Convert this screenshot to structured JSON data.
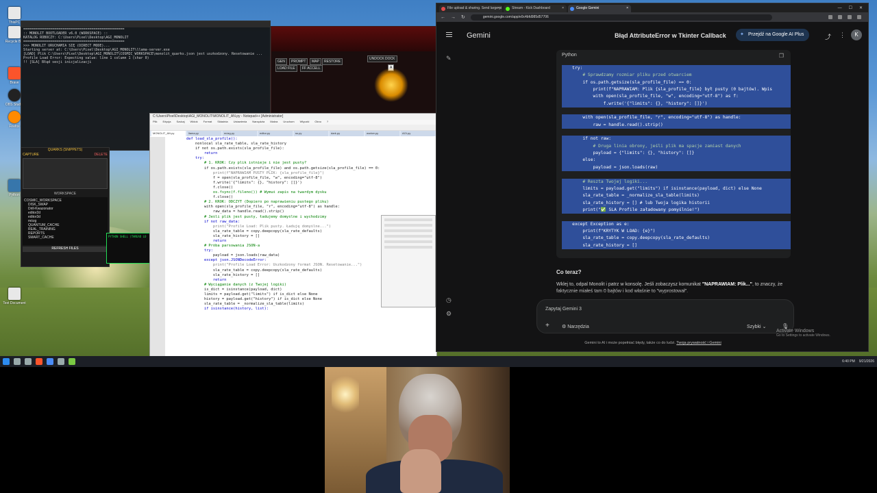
{
  "desktop": {
    "icons": [
      {
        "label": "ThisPC"
      },
      {
        "label": "Recycle Bin"
      },
      {
        "label": "Brave"
      },
      {
        "label": "OBS Studio"
      },
      {
        "label": "Firefox"
      },
      {
        "label": "Python"
      },
      {
        "label": "Text Document"
      }
    ]
  },
  "terminal": {
    "lines": [
      "=================================================",
      ":: MONOLIT BOOTLOADER v6.0 (WORKSPACE) ::",
      "KATALOG ROBOCZY: C:\\Users\\Pixel\\Desktop\\AGI_MONOLIT",
      "=================================================",
      ">>> MONOLIT URUCHAMIA SIĘ (DIRECT MODE)...",
      "Starting server at: C:\\Users\\Pixel\\Desktop\\AGI_MONOLIT\\llama-server.exe",
      "[LOAD] Plik C:\\Users\\Pixel\\Desktop\\AGI_MONOLIT\\COSMIC_WORKSPACE\\monolit_quarks.json jest uszkodzony. Resetowanie ...",
      "Profile Load Error: Expecting value: line 1 column 1 (char 0)",
      "!! [SLA] Błąd sesji inicjalizacji"
    ]
  },
  "darkapp": {
    "tab_label": "UNDOCK  DOCK",
    "input_value": "A",
    "buttons": [
      "GEN",
      "PROMPT",
      "MAP",
      "RESTORE",
      "LOAD FILE",
      "FF ACCELL"
    ]
  },
  "quarks": {
    "title": "QUARKS (SNIPPETS)",
    "capture": "CAPTURE",
    "delete": "DELETE",
    "workspace_label": "WORKSPACE",
    "tree": [
      "COSMIC_WORKSPACE",
      "DISK_SWAP",
      "Drill-Kwazonator",
      "editor2d",
      "editor3d",
      "mózg",
      "QUANTUM_CACHE",
      "REAL_TRAINING",
      "REPORTS",
      "SMART_CACHE"
    ],
    "refresh": "REFRESH FILES",
    "shell_title": "PYTHON SHELL (THREAD LO"
  },
  "editor": {
    "title": "C:\\Users\\Pixel\\Desktop\\AGI_MONOLIT\\MONOLIT_AN.py - Notepad++ [Administrator]",
    "menu": [
      "Plik",
      "Edycja",
      "Szukaj",
      "Widok",
      "Format",
      "Składnia",
      "Ustawienia",
      "Narzędzia",
      "Makra",
      "Uruchom",
      "Wtyczki",
      "Okno",
      "?"
    ],
    "tabs": [
      "MONOLIT_AN.py",
      "llama.py",
      "mózg.py",
      "editor.py",
      "ss.py",
      "dark.py",
      "worker.py",
      "AGI.py"
    ],
    "code": [
      {
        "t": "    def load_sla_profile():",
        "k": "kw"
      },
      {
        "t": "        nonlocal sla_rate_table, sla_rate_history",
        "k": ""
      },
      {
        "t": "",
        "k": ""
      },
      {
        "t": "        if not os.path.exists(sla_profile_file):",
        "k": ""
      },
      {
        "t": "            return",
        "k": "kw"
      },
      {
        "t": "",
        "k": ""
      },
      {
        "t": "        try:",
        "k": "kw"
      },
      {
        "t": "            # 1. KROK: Czy plik istnieje i nie jest pusty?",
        "k": "cm"
      },
      {
        "t": "            if os.path.exists(sla_profile_file) and os.path.getsize(sla_profile_file) == 0:",
        "k": ""
      },
      {
        "t": "                print(f\"NAPRAWIAM PUSTY PLIK: {sla_profile_file}\")",
        "k": "st"
      },
      {
        "t": "                f = open(sla_profile_file, \"w\", encoding=\"utf-8\")",
        "k": ""
      },
      {
        "t": "                f.write('{\"limits\": {}, \"history\": []}')",
        "k": ""
      },
      {
        "t": "                f.close()",
        "k": ""
      },
      {
        "t": "",
        "k": ""
      },
      {
        "t": "                os.fsync(f.fileno()) # Wymuś zapis na twardym dysku",
        "k": "cm"
      },
      {
        "t": "                f.close()",
        "k": ""
      },
      {
        "t": "",
        "k": ""
      },
      {
        "t": "            # 2. KROK: ODCZYT (Dopiero po naprawieniu pustego pliku)",
        "k": "cm"
      },
      {
        "t": "            with open(sla_profile_file, \"r\", encoding=\"utf-8\") as handle:",
        "k": ""
      },
      {
        "t": "                raw_data = handle.read().strip()",
        "k": ""
      },
      {
        "t": "            # Jeśli plik jest pusty, ładujemy domyślne i wychodzimy",
        "k": "cm"
      },
      {
        "t": "            if not raw_data:",
        "k": "kw"
      },
      {
        "t": "                print(\"Profile Load: Plik pusty. Ładuję domyślne...\")",
        "k": "st"
      },
      {
        "t": "                sla_rate_table = copy.deepcopy(sla_rate_defaults)",
        "k": ""
      },
      {
        "t": "                sla_rate_history = []",
        "k": ""
      },
      {
        "t": "                return",
        "k": "kw"
      },
      {
        "t": "",
        "k": ""
      },
      {
        "t": "            # Próba parsowania JSON-a",
        "k": "cm"
      },
      {
        "t": "            try:",
        "k": "kw"
      },
      {
        "t": "                payload = json.loads(raw_data)",
        "k": ""
      },
      {
        "t": "            except json.JSONDecodeError:",
        "k": "kw"
      },
      {
        "t": "                print(\"Profile Load Error: Uszkodzony format JSON. Resetowanie...\")",
        "k": "st"
      },
      {
        "t": "                sla_rate_table = copy.deepcopy(sla_rate_defaults)",
        "k": ""
      },
      {
        "t": "                sla_rate_history = []",
        "k": ""
      },
      {
        "t": "                return",
        "k": "kw"
      },
      {
        "t": "",
        "k": ""
      },
      {
        "t": "            # Wyciąganie danych (z Twojej logiki)",
        "k": "cm"
      },
      {
        "t": "            is_dict = isinstance(payload, dict)",
        "k": ""
      },
      {
        "t": "            limits = payload.get(\"limits\") if is_dict else None",
        "k": ""
      },
      {
        "t": "            history = payload.get(\"history\") if is_dict else None",
        "k": ""
      },
      {
        "t": "",
        "k": ""
      },
      {
        "t": "            sla_rate_table = _normalize_sla_table(limits)",
        "k": ""
      },
      {
        "t": "",
        "k": ""
      },
      {
        "t": "            if isinstance(history, list):",
        "k": "kw"
      }
    ]
  },
  "browser": {
    "tabs": [
      {
        "label": "File upload & sharing. Send large pi",
        "color": "#e04b4b"
      },
      {
        "label": "Stream - Kick Dashboard",
        "color": "#53fc18"
      },
      {
        "label": "Google Gemini",
        "color": "#4a8cf7"
      }
    ],
    "url": "gemini.google.com/app/e0c4bfd985d57706"
  },
  "gemini": {
    "brand": "Gemini",
    "chat_title": "Błąd AttributeError w Tkinter Callback",
    "plus_button": "Przejdź na Google AI Plus",
    "avatar_letter": "K",
    "code_lang": "Python",
    "code_lines": [
      {
        "t": "    try:",
        "c": false
      },
      {
        "t": "        # Sprawdzamy rozmiar pliku przed otwarciem",
        "c": true
      },
      {
        "t": "        if os.path.getsize(sla_profile_file) == 0:",
        "c": false
      },
      {
        "t": "            print(f\"NAPRAWIAM: Plik {sla_profile_file} był pusty (0 bajtów). Wpis",
        "c": false
      },
      {
        "t": "            with open(sla_profile_file, \"w\", encoding=\"utf-8\") as f:",
        "c": false
      },
      {
        "t": "                f.write('{\"limits\": {}, \"history\": []}')",
        "c": false
      },
      {
        "t": "",
        "c": false
      },
      {
        "t": "        with open(sla_profile_file, \"r\", encoding=\"utf-8\") as handle:",
        "c": false
      },
      {
        "t": "            raw = handle.read().strip()",
        "c": false
      },
      {
        "t": "",
        "c": false
      },
      {
        "t": "        if not raw:",
        "c": false
      },
      {
        "t": "            # Druga linia obrony, jeśli plik ma spacje zamiast danych",
        "c": true
      },
      {
        "t": "            payload = {\"limits\": {}, \"history\": []}",
        "c": false
      },
      {
        "t": "        else:",
        "c": false
      },
      {
        "t": "            payload = json.loads(raw)",
        "c": false
      },
      {
        "t": "",
        "c": false
      },
      {
        "t": "        # Reszta Twojej logiki...",
        "c": true
      },
      {
        "t": "        limits = payload.get(\"limits\") if isinstance(payload, dict) else None",
        "c": false
      },
      {
        "t": "        sla_rate_table = _normalize_sla_table(limits)",
        "c": false
      },
      {
        "t": "        sla_rate_history = [] # lub Twoja logika historii",
        "c": false
      },
      {
        "t": "        print(\"✅ SLA Profile załadowany pomyślnie!\")",
        "c": false
      },
      {
        "t": "",
        "c": false
      },
      {
        "t": "    except Exception as e:",
        "c": false
      },
      {
        "t": "        print(f\"KRYTYK W LOAD: {e}\")",
        "c": false
      },
      {
        "t": "        sla_rate_table = copy.deepcopy(sla_rate_defaults)",
        "c": false
      },
      {
        "t": "        sla_rate_history = []",
        "c": false
      }
    ],
    "response_heading": "Co teraz?",
    "response_pre": "Wklej to, odpal Monolit i patrz w konsolę. Jeśli zobaczysz komunikat ",
    "response_bold": "\"NAPRAWIAM: Plik...\"",
    "response_post": ", to znaczy, że faktycznie miałeś tam 0 bajtów i kod właśnie to \"wyprostował\".",
    "input_placeholder": "Zapytaj Gemini 3",
    "tools_label": "Narzędzia",
    "mode_label": "Szybki",
    "activate_title": "Activate Windows",
    "activate_sub": "Go to Settings to activate Windows.",
    "disclaimer": "Gemini to AI i może popełniać błędy, także co do ludzi.",
    "privacy_link": "Twoja prywatność i Gemini"
  },
  "taskbar": {
    "time": "6:40 PM",
    "date": "9/21/2026"
  }
}
